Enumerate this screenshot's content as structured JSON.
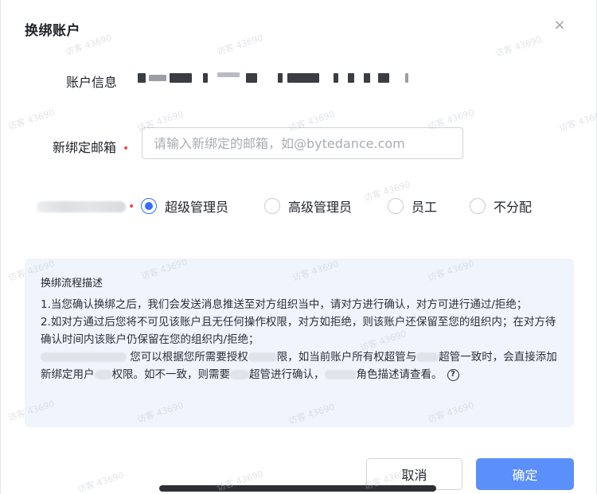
{
  "dialog": {
    "title": "换绑账户",
    "close_glyph": "×"
  },
  "account": {
    "label": "账户信息"
  },
  "email": {
    "label": "新绑定邮箱",
    "required_mark": "•",
    "placeholder": "请输入新绑定的邮箱，如@bytedance.com",
    "value": ""
  },
  "role": {
    "required_mark": "•",
    "options": [
      {
        "label": "超级管理员",
        "checked": true
      },
      {
        "label": "高级管理员",
        "checked": false
      },
      {
        "label": "员工",
        "checked": false
      },
      {
        "label": "不分配",
        "checked": false
      }
    ]
  },
  "description": {
    "title": "换绑流程描述",
    "line1": "1.当您确认换绑之后，我们会发送消息推送至对方组织当中，请对方进行确认，对方可进行通过/拒绝；",
    "line2": "2.如对方通过后您将不可见该账户且无任何操作权限，对方如拒绝，则该账户还保留至您的组织内；在对方待确认时间内该账户仍保留在您的组织内/拒绝；",
    "line3_a": "您可以根据您所需要授权",
    "line3_b": "限，如当前账户所有权超管与",
    "line3_c": "超管一致时，会直接添加新绑定用户",
    "line3_d": "权限。如不一致，则需要",
    "line3_e": "超管进行确认，",
    "line3_f": "角色描述请查看。"
  },
  "buttons": {
    "cancel": "取消",
    "ok": "确定"
  },
  "watermark": "访客 43690"
}
